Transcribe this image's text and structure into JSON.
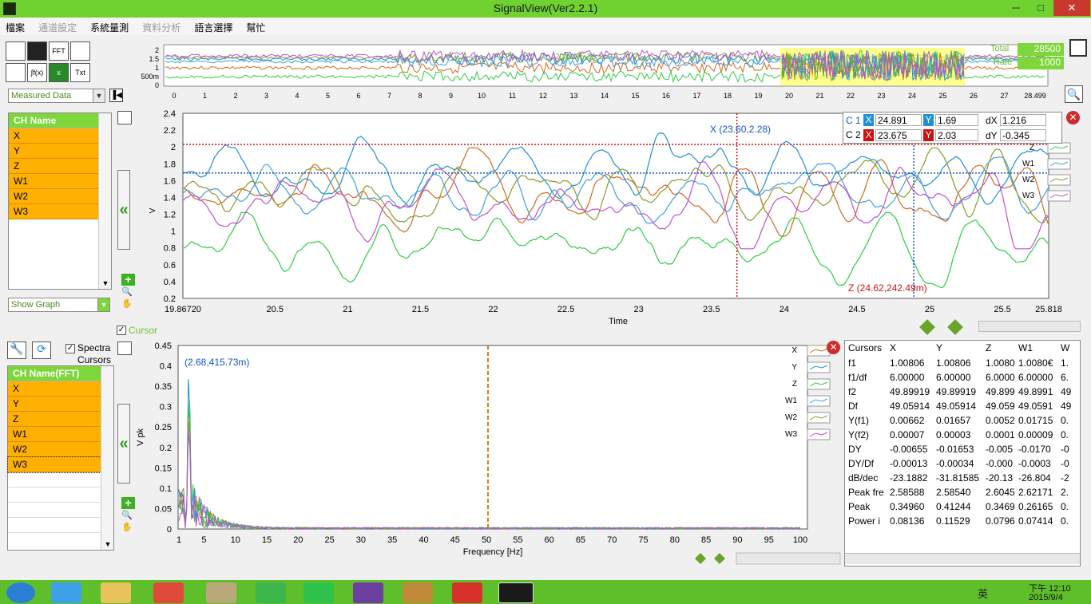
{
  "window": {
    "title": "SignalView(Ver2.2.1)",
    "minimize": "─",
    "maximize": "□",
    "close": "✕"
  },
  "menu": {
    "items": [
      "檔案",
      "通道設定",
      "系統量測",
      "資料分析",
      "語言選擇",
      "幫忙"
    ],
    "disabled": [
      1,
      3
    ]
  },
  "toolbar": {
    "labels": [
      "",
      "",
      "FFT",
      "",
      "",
      "∫f(x)",
      "x",
      "Txt"
    ]
  },
  "data_source": {
    "selected": "Measured Data"
  },
  "overview": {
    "y_ticks": [
      "2",
      "1.5",
      "1",
      "500m",
      "0"
    ],
    "x_ticks": [
      "0",
      "1",
      "2",
      "3",
      "4",
      "5",
      "6",
      "7",
      "8",
      "9",
      "10",
      "11",
      "12",
      "13",
      "14",
      "15",
      "16",
      "17",
      "18",
      "19",
      "20",
      "21",
      "22",
      "23",
      "24",
      "25",
      "26",
      "27",
      "28.499"
    ],
    "date_label": "2015-05-30 1",
    "total_label": "Total",
    "total_value": "28500",
    "rate_label": "Rate",
    "rate_value": "1000"
  },
  "ch_list": {
    "header": "CH Name",
    "items": [
      "X",
      "Y",
      "Z",
      "W1",
      "W2",
      "W3"
    ]
  },
  "show_graph": {
    "selected": "Show Graph"
  },
  "main_chart": {
    "y_ticks": [
      "2.4",
      "2.2",
      "2",
      "1.8",
      "1.6",
      "1.4",
      "1.2",
      "1",
      "0.8",
      "0.6",
      "0.4",
      "0.2"
    ],
    "x_ticks": [
      "19.86720",
      "20.5",
      "21",
      "21.5",
      "22",
      "22.5",
      "23",
      "23.5",
      "24",
      "24.5",
      "25",
      "25.5",
      "25.818"
    ],
    "xlabel": "Time",
    "ylabel": "V",
    "annotation_x": "X (23.60,2.28)",
    "annotation_z": "Z (24.62,242.49m)",
    "legend": [
      "Z",
      "W1",
      "W2",
      "W3"
    ]
  },
  "cursor_readout": {
    "c1_label": "C 1",
    "c1_x": "24.891",
    "c1_y": "1.69",
    "c2_label": "C 2",
    "c2_x": "23.675",
    "c2_y": "2.03",
    "x_icon": "X",
    "y_icon": "Y",
    "dx_label": "dX",
    "dx": "1.216",
    "dy_label": "dY",
    "dy": "-0.345"
  },
  "cursor_checkbox": {
    "label": "Cursor",
    "checked": true
  },
  "spectra_cursors": {
    "label1": "Spectra",
    "label2": "Cursors",
    "checked": true
  },
  "fft_list": {
    "header": "CH Name(FFT)",
    "items": [
      "X",
      "Y",
      "Z",
      "W1",
      "W2",
      "W3"
    ]
  },
  "fft_chart": {
    "y_ticks": [
      "0.45",
      "0.4",
      "0.35",
      "0.3",
      "0.25",
      "0.2",
      "0.15",
      "0.1",
      "0.05",
      "0"
    ],
    "x_ticks": [
      "1",
      "5",
      "10",
      "15",
      "20",
      "25",
      "30",
      "35",
      "40",
      "45",
      "50",
      "55",
      "60",
      "65",
      "70",
      "75",
      "80",
      "85",
      "90",
      "95",
      "100"
    ],
    "xlabel": "Frequency [Hz]",
    "ylabel": "V pk",
    "annotation": "(2.68,415.73m)",
    "legend": [
      "X",
      "Y",
      "Z",
      "W1",
      "W2",
      "W3"
    ]
  },
  "stats_table": {
    "columns": [
      "Cursors",
      "X",
      "Y",
      "Z",
      "W1",
      "W"
    ],
    "rows": [
      [
        "f1",
        "1.00806",
        "1.00806",
        "1.0080",
        "1.0080€",
        "1."
      ],
      [
        "f1/df",
        "6.00000",
        "6.00000",
        "6.0000",
        "6.00000",
        "6."
      ],
      [
        "f2",
        "49.89919",
        "49.89919",
        "49.899",
        "49.8991",
        "49"
      ],
      [
        "Df",
        "49.05914",
        "49.05914",
        "49.059",
        "49.0591",
        "49"
      ],
      [
        "Y(f1)",
        "0.00662",
        "0.01657",
        "0.0052",
        "0.01715",
        "0."
      ],
      [
        "Y(f2)",
        "0.00007",
        "0.00003",
        "0.0001",
        "0.00009",
        "0."
      ],
      [
        "DY",
        "-0.00655",
        "-0.01653",
        "-0.005",
        "-0.0170",
        "-0"
      ],
      [
        "DY/Df",
        "-0.00013",
        "-0.00034",
        "-0.000",
        "-0.0003",
        "-0"
      ],
      [
        "dB/dec",
        "-23.1882",
        "-31.81585",
        "-20.13",
        "-26.804",
        "-2"
      ],
      [
        "Peak fre",
        "2.58588",
        "2.58540",
        "2.6045",
        "2.62171",
        "2."
      ],
      [
        "Peak",
        "0.34960",
        "0.41244",
        "0.3469",
        "0.26165",
        "0."
      ],
      [
        "Power i",
        "0.08136",
        "0.11529",
        "0.0796",
        "0.07414",
        "0."
      ]
    ]
  },
  "tray": {
    "ime": "英",
    "clock_time": "下午 12:10",
    "clock_date": "2015/9/4"
  },
  "colors": {
    "X": "#d2691e",
    "Y": "#1e90d6",
    "Z": "#2ecc40",
    "W1": "#3fa0e0",
    "W2": "#8c9a2a",
    "W3": "#c050d0",
    "accent_green": "#6fd230",
    "channel_orange": "#ffb000",
    "cursor_red": "#cc1111",
    "cursor_blue": "#1155cc"
  }
}
